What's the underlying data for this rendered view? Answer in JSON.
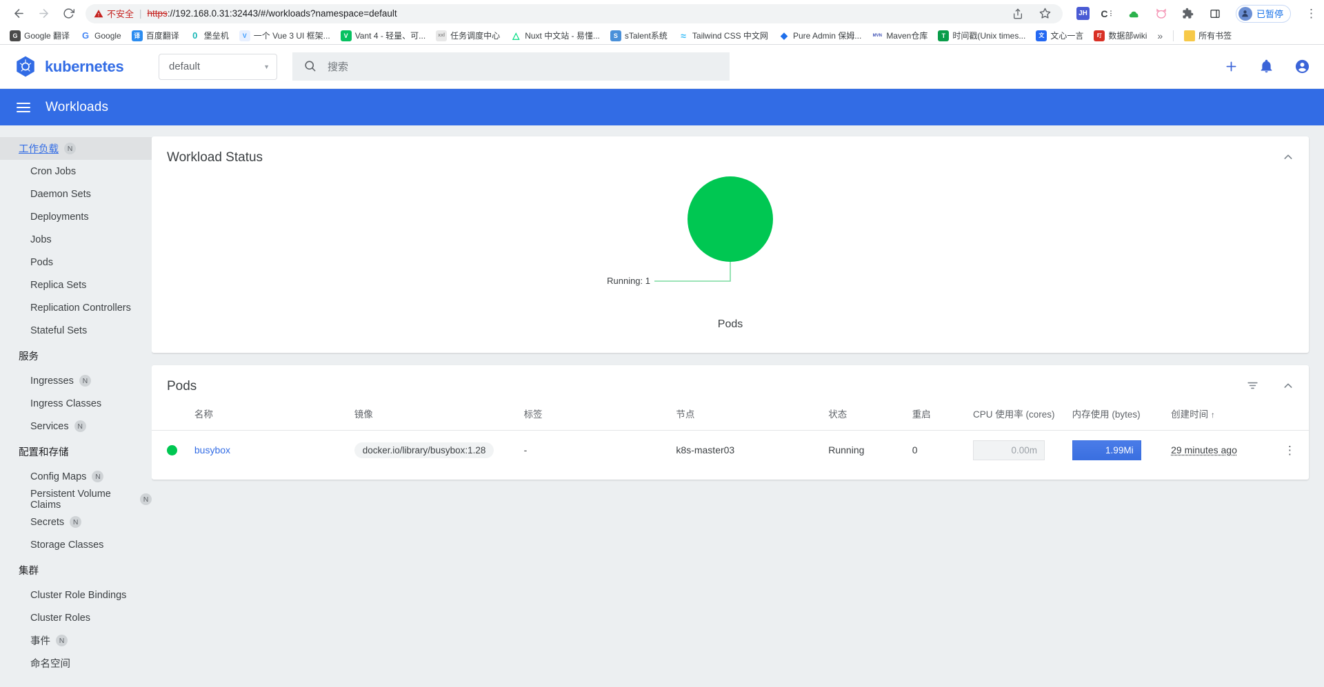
{
  "browser": {
    "nav": {
      "back": "←",
      "forward": "→",
      "reload": "⟳"
    },
    "security_warning": "不安全",
    "url_scheme": "https",
    "url_rest": "://192.168.0.31:32443/#/workloads?namespace=default",
    "share_icon": "share-icon",
    "bookmark_star_icon": "star-icon",
    "extensions": [
      {
        "name": "jihulab-extension",
        "label": "JH",
        "color": "#4a5bd4"
      },
      {
        "name": "c-extension",
        "label": "C",
        "color": "#3c4043"
      },
      {
        "name": "baidu-netdisk-extension",
        "label": "☁",
        "color": "#2bb24c"
      },
      {
        "name": "cat-extension",
        "label": "◠",
        "color": "#f48fb1"
      },
      {
        "name": "puzzle-extensions",
        "label": "🧩",
        "color": "#5f6368"
      },
      {
        "name": "sidepanel-toggle",
        "label": "▢",
        "color": "#3c4043"
      }
    ],
    "paused_label": "已暂停",
    "menu_icon": "kebab-menu-icon",
    "bookmarks": [
      {
        "label": "Google 翻译",
        "icon": "G",
        "color": "#4a4a4a"
      },
      {
        "label": "Google",
        "icon": "G",
        "color": "#ffffff"
      },
      {
        "label": "百度翻译",
        "icon": "译",
        "color": "#2b8cf0"
      },
      {
        "label": "堡垒机",
        "icon": "0",
        "color": "#ffffff"
      },
      {
        "label": "一个 Vue 3 UI 框架...",
        "icon": "V",
        "color": "#e8f0ff"
      },
      {
        "label": "Vant 4 - 轻量、可...",
        "icon": "V",
        "color": "#07c160"
      },
      {
        "label": "任务调度中心",
        "icon": "xxl",
        "color": "#e8e8e8"
      },
      {
        "label": "Nuxt 中文站 - 易懂...",
        "icon": "N",
        "color": "#00dc82"
      },
      {
        "label": "sTalent系统",
        "icon": "S",
        "color": "#4a90d9"
      },
      {
        "label": "Tailwind CSS 中文网",
        "icon": "~",
        "color": "#38bdf8"
      },
      {
        "label": "Pure Admin 保姆...",
        "icon": "◆",
        "color": "#1f6feb"
      },
      {
        "label": "Maven仓库",
        "icon": "MVN",
        "color": "#ffffff"
      },
      {
        "label": "时间戳(Unix times...",
        "icon": "T",
        "color": "#0a9d4a"
      },
      {
        "label": "文心一言",
        "icon": "文",
        "color": "#2468f2"
      },
      {
        "label": "数据部wiki",
        "icon": "叮",
        "color": "#d93025"
      }
    ],
    "bookmarks_overflow": "»",
    "all_bookmarks_label": "所有书签",
    "all_bookmarks_icon": "folder-icon"
  },
  "app": {
    "logo_text": "kubernetes",
    "namespace_value": "default",
    "namespace_caret": "▾",
    "search_placeholder": "搜索",
    "search_icon": "search-icon",
    "actions": [
      {
        "name": "create-button",
        "glyph": "+"
      },
      {
        "name": "notifications-button",
        "glyph": "bell"
      },
      {
        "name": "account-button",
        "glyph": "account"
      }
    ],
    "page_title": "Workloads",
    "accent_color": "#326ce5"
  },
  "sidebar": {
    "items": [
      {
        "label": "工作负载",
        "badge": "N",
        "active": true,
        "type": "item"
      },
      {
        "label": "Cron Jobs",
        "badge": "",
        "active": false,
        "type": "item"
      },
      {
        "label": "Daemon Sets",
        "badge": "",
        "active": false,
        "type": "item"
      },
      {
        "label": "Deployments",
        "badge": "",
        "active": false,
        "type": "item"
      },
      {
        "label": "Jobs",
        "badge": "",
        "active": false,
        "type": "item"
      },
      {
        "label": "Pods",
        "badge": "",
        "active": false,
        "type": "item"
      },
      {
        "label": "Replica Sets",
        "badge": "",
        "active": false,
        "type": "item"
      },
      {
        "label": "Replication Controllers",
        "badge": "",
        "active": false,
        "type": "item"
      },
      {
        "label": "Stateful Sets",
        "badge": "",
        "active": false,
        "type": "item"
      },
      {
        "label": "服务",
        "badge": "",
        "active": false,
        "type": "section"
      },
      {
        "label": "Ingresses",
        "badge": "N",
        "active": false,
        "type": "item"
      },
      {
        "label": "Ingress Classes",
        "badge": "",
        "active": false,
        "type": "item"
      },
      {
        "label": "Services",
        "badge": "N",
        "active": false,
        "type": "item"
      },
      {
        "label": "配置和存储",
        "badge": "",
        "active": false,
        "type": "section"
      },
      {
        "label": "Config Maps",
        "badge": "N",
        "active": false,
        "type": "item"
      },
      {
        "label": "Persistent Volume Claims",
        "badge": "N",
        "active": false,
        "type": "item"
      },
      {
        "label": "Secrets",
        "badge": "N",
        "active": false,
        "type": "item"
      },
      {
        "label": "Storage Classes",
        "badge": "",
        "active": false,
        "type": "item"
      },
      {
        "label": "集群",
        "badge": "",
        "active": false,
        "type": "section"
      },
      {
        "label": "Cluster Role Bindings",
        "badge": "",
        "active": false,
        "type": "item"
      },
      {
        "label": "Cluster Roles",
        "badge": "",
        "active": false,
        "type": "item"
      },
      {
        "label": "事件",
        "badge": "N",
        "active": false,
        "type": "item"
      },
      {
        "label": "命名空间",
        "badge": "",
        "active": false,
        "type": "item"
      }
    ]
  },
  "workload_status": {
    "title": "Workload Status",
    "collapse_icon": "chevron-up-icon"
  },
  "chart_data": {
    "type": "pie",
    "title": "Workload Status",
    "caption": "Pods",
    "labels": [
      "Running: 1"
    ],
    "categories": [
      "Running"
    ],
    "values": [
      1
    ],
    "colors": [
      "#00c752"
    ],
    "leader_line_color": "#7bdba0",
    "legend": "callout",
    "grid": false
  },
  "pods_card": {
    "title": "Pods",
    "filter_icon": "filter-icon",
    "collapse_icon": "chevron-up-icon",
    "columns": [
      "",
      "名称",
      "镜像",
      "标签",
      "节点",
      "状态",
      "重启",
      "CPU 使用率 (cores)",
      "内存使用 (bytes)",
      "创建时间",
      ""
    ],
    "sort_column": "创建时间",
    "sort_arrow": "↑",
    "rows": [
      {
        "status_color": "#00c752",
        "name": "busybox",
        "image": "docker.io/library/busybox:1.28",
        "labels": "-",
        "node": "k8s-master03",
        "status": "Running",
        "restarts": "0",
        "cpu": "0.00m",
        "memory": "1.99Mi",
        "created": "29 minutes ago",
        "menu_icon": "row-kebab-icon"
      }
    ]
  }
}
